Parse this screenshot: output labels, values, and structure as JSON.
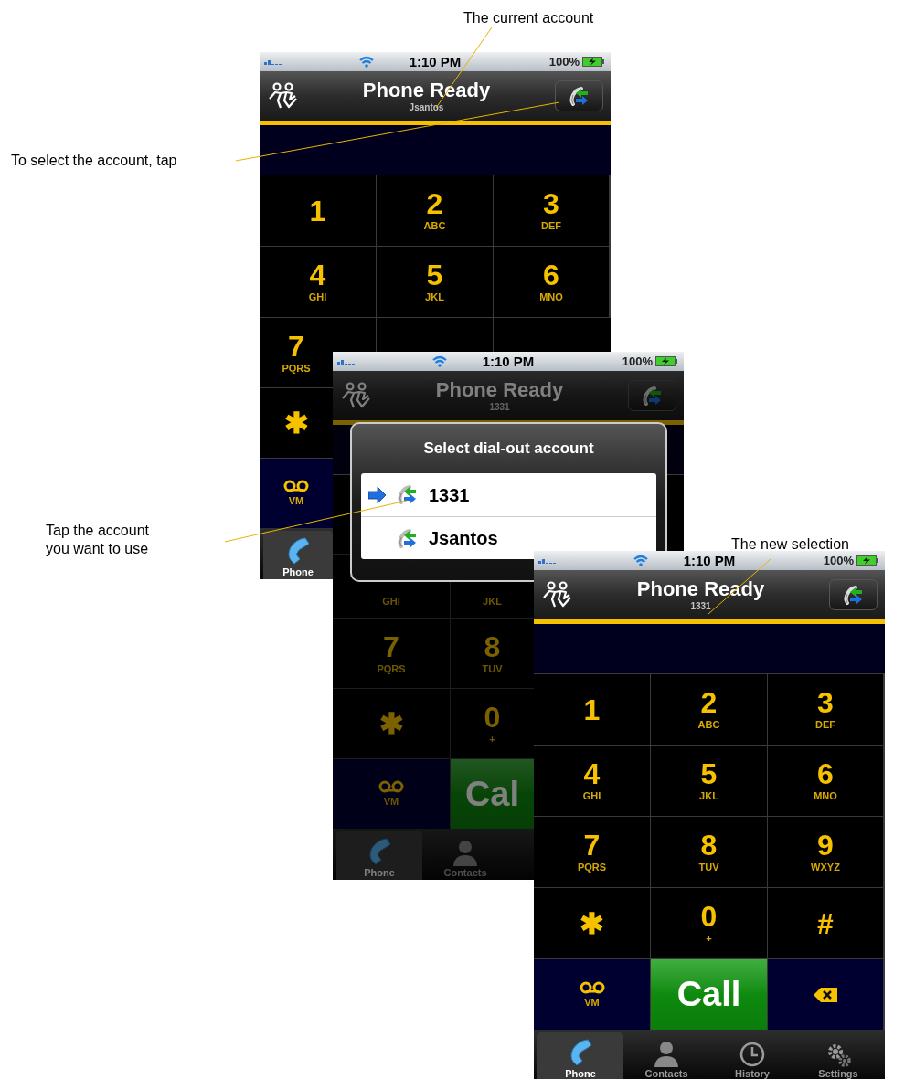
{
  "callouts": [
    {
      "text": "The current account"
    },
    {
      "text": "To select the account, tap"
    },
    {
      "text": "Tap the account\nyou want to use"
    },
    {
      "text": "The new selection"
    }
  ],
  "screens": [
    {
      "status": {
        "time": "1:10 PM",
        "battery": "100%"
      },
      "header": {
        "title": "Phone Ready",
        "account": "Jsantos"
      },
      "dimmed": false,
      "keypad": [
        [
          {
            "kind": "digit",
            "digit": "1"
          },
          {
            "kind": "digit",
            "digit": "2",
            "letters": "ABC"
          },
          {
            "kind": "digit",
            "digit": "3",
            "letters": "DEF"
          }
        ],
        [
          {
            "kind": "digit",
            "digit": "4",
            "letters": "GHI"
          },
          {
            "kind": "digit",
            "digit": "5",
            "letters": "JKL"
          },
          {
            "kind": "digit",
            "digit": "6",
            "letters": "MNO"
          }
        ],
        [
          {
            "kind": "digit",
            "digit": "7",
            "letters": "PQRS"
          }
        ],
        [
          {
            "kind": "digit",
            "digit": "✱"
          }
        ],
        [
          {
            "kind": "voicemail",
            "label": "VM"
          }
        ]
      ],
      "tabs": [
        {
          "label": "Phone",
          "selected": true
        }
      ]
    },
    {
      "status": {
        "time": "1:10 PM",
        "battery": "100%"
      },
      "header": {
        "title": "Phone Ready",
        "account": "1331"
      },
      "dimmed": true,
      "dialog": {
        "title": "Select dial-out account",
        "accounts": [
          {
            "name": "1331",
            "selected": true
          },
          {
            "name": "Jsantos",
            "selected": false
          }
        ]
      },
      "keypad": [
        [
          {
            "kind": "digit",
            "letters": "GHI"
          },
          {
            "kind": "digit",
            "letters": "JKL"
          }
        ],
        [
          {
            "kind": "digit",
            "digit": "7",
            "letters": "PQRS"
          },
          {
            "kind": "digit",
            "digit": "8",
            "letters": "TUV"
          }
        ],
        [
          {
            "kind": "digit",
            "digit": "✱"
          },
          {
            "kind": "digit",
            "digit": "0",
            "letters": "+"
          }
        ],
        [
          {
            "kind": "voicemail",
            "label": "VM"
          },
          {
            "kind": "call",
            "label": "Cal"
          }
        ]
      ],
      "tabs": [
        {
          "label": "Phone",
          "selected": true
        },
        {
          "label": "Contacts",
          "selected": false
        }
      ]
    },
    {
      "status": {
        "time": "1:10 PM",
        "battery": "100%"
      },
      "header": {
        "title": "Phone Ready",
        "account": "1331"
      },
      "dimmed": false,
      "keypad": [
        [
          {
            "kind": "digit",
            "digit": "1"
          },
          {
            "kind": "digit",
            "digit": "2",
            "letters": "ABC"
          },
          {
            "kind": "digit",
            "digit": "3",
            "letters": "DEF"
          }
        ],
        [
          {
            "kind": "digit",
            "digit": "4",
            "letters": "GHI"
          },
          {
            "kind": "digit",
            "digit": "5",
            "letters": "JKL"
          },
          {
            "kind": "digit",
            "digit": "6",
            "letters": "MNO"
          }
        ],
        [
          {
            "kind": "digit",
            "digit": "7",
            "letters": "PQRS"
          },
          {
            "kind": "digit",
            "digit": "8",
            "letters": "TUV"
          },
          {
            "kind": "digit",
            "digit": "9",
            "letters": "WXYZ"
          }
        ],
        [
          {
            "kind": "digit",
            "digit": "✱"
          },
          {
            "kind": "digit",
            "digit": "0",
            "letters": "+"
          },
          {
            "kind": "digit",
            "digit": "#"
          }
        ],
        [
          {
            "kind": "voicemail",
            "label": "VM"
          },
          {
            "kind": "call",
            "label": "Call"
          },
          {
            "kind": "delete"
          }
        ]
      ],
      "tabs": [
        {
          "label": "Phone",
          "selected": true
        },
        {
          "label": "Contacts",
          "selected": false
        },
        {
          "label": "History",
          "selected": false
        },
        {
          "label": "Settings",
          "selected": false
        }
      ]
    }
  ]
}
